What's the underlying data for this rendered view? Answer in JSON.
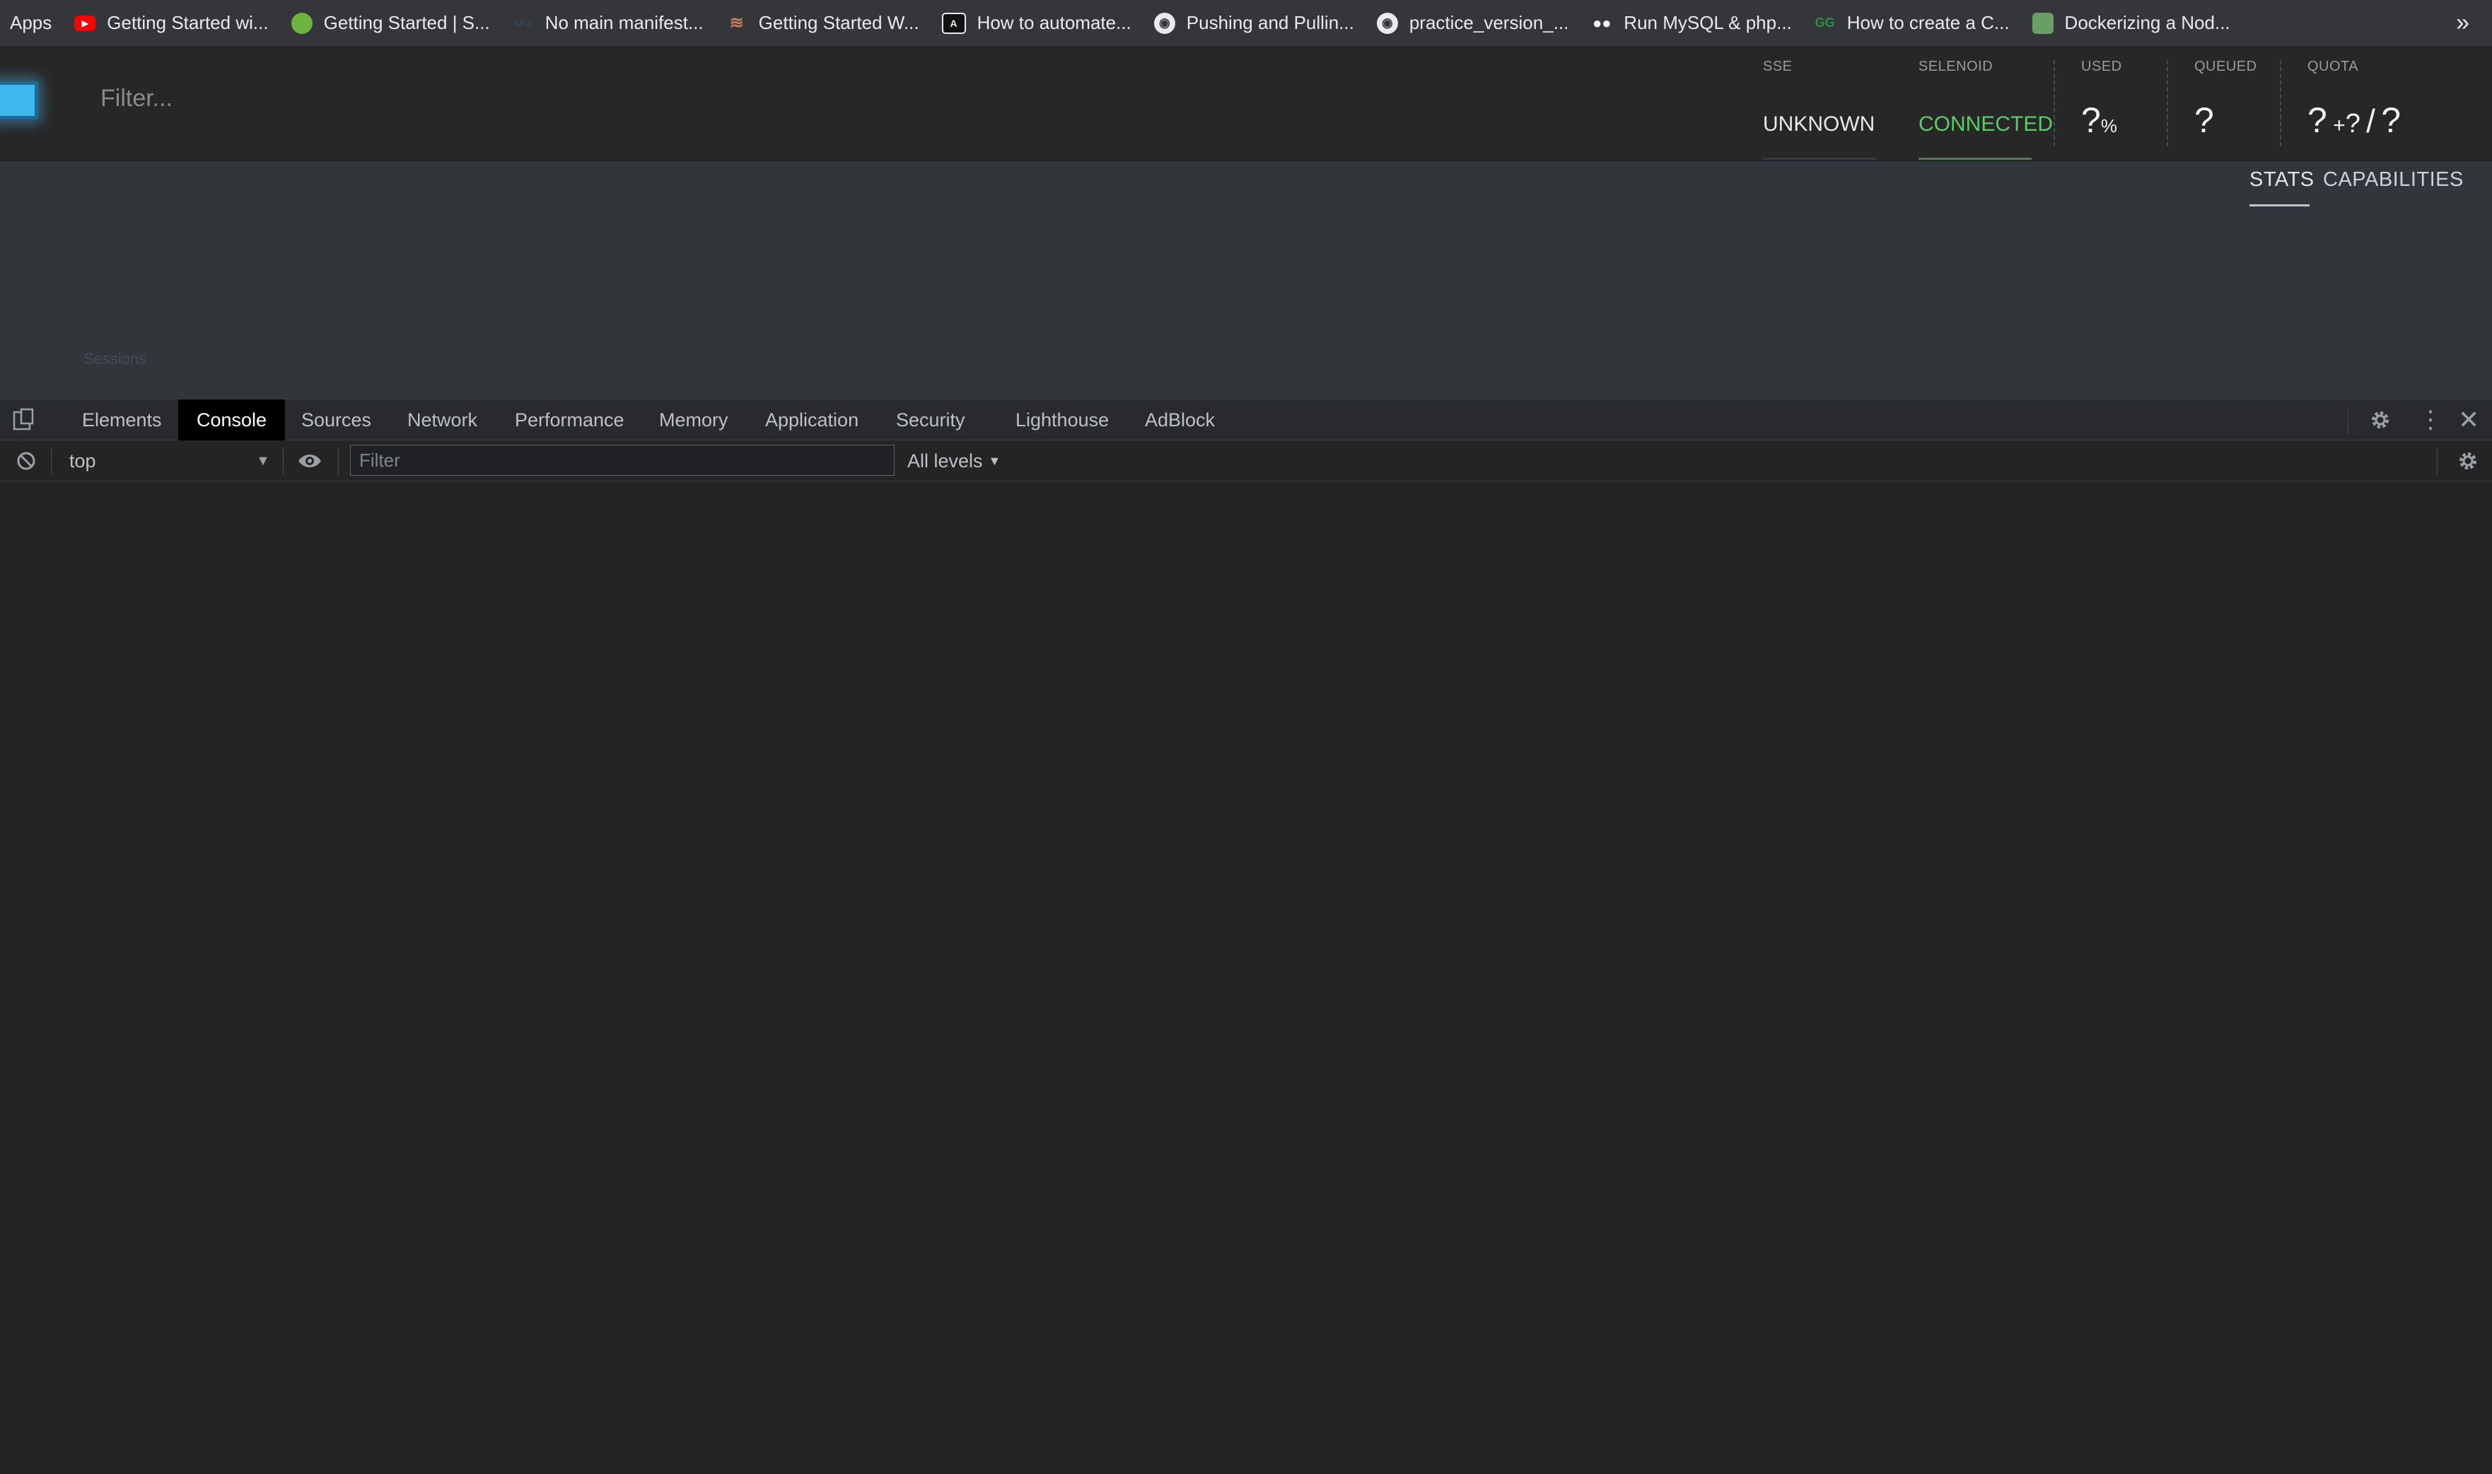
{
  "bookmarks": {
    "apps_label": "Apps",
    "items": [
      {
        "label": "Getting Started wi...",
        "icon": "youtube-icon",
        "color": "#ff0000"
      },
      {
        "label": "Getting Started | S...",
        "icon": "spring-icon",
        "color": "#6db33f"
      },
      {
        "label": "No main manifest...",
        "icon": "stackoverflow-icon",
        "color": "#2e4a55"
      },
      {
        "label": "Getting Started W...",
        "icon": "docker-doc-icon",
        "color": "#c67b5c"
      },
      {
        "label": "How to automate...",
        "icon": "automation-icon",
        "color": "#e8eaed"
      },
      {
        "label": "Pushing and Pullin...",
        "icon": "globe-icon",
        "color": "#e8eaed"
      },
      {
        "label": "practice_version_...",
        "icon": "globe-icon",
        "color": "#e8eaed"
      },
      {
        "label": "Run MySQL & php...",
        "icon": "medium-icon",
        "color": "#ffffff"
      },
      {
        "label": "How to create a C...",
        "icon": "geeksforgeeks-icon",
        "color": "#2f8d46"
      },
      {
        "label": "Dockerizing a Nod...",
        "icon": "nodejs-icon",
        "color": "#68a063"
      }
    ],
    "overflow_label": "»"
  },
  "header": {
    "filter_placeholder": "Filter...",
    "stats": {
      "sse": {
        "label": "SSE",
        "value": "UNKNOWN"
      },
      "selenoid": {
        "label": "SELENOID",
        "value": "CONNECTED",
        "color": "#5fca6b"
      },
      "used": {
        "label": "USED",
        "value": "?",
        "unit": "%"
      },
      "queued": {
        "label": "QUEUED",
        "value": "?"
      },
      "quota": {
        "label": "QUOTA",
        "value": "?",
        "plus": "+",
        "pending": "?",
        "slash": "/",
        "total": "?"
      }
    }
  },
  "stats_panel": {
    "tabs": [
      "STATS",
      "CAPABILITIES"
    ],
    "active_tab": "STATS",
    "sessions_label": "Sessions"
  },
  "devtools": {
    "tabs": [
      "Elements",
      "Console",
      "Sources",
      "Network",
      "Performance",
      "Memory",
      "Application",
      "Security",
      "Lighthouse",
      "AdBlock"
    ],
    "active_tab": "Console",
    "toolbar": {
      "context": "top",
      "filter_placeholder": "Filter",
      "levels": "All levels"
    }
  }
}
